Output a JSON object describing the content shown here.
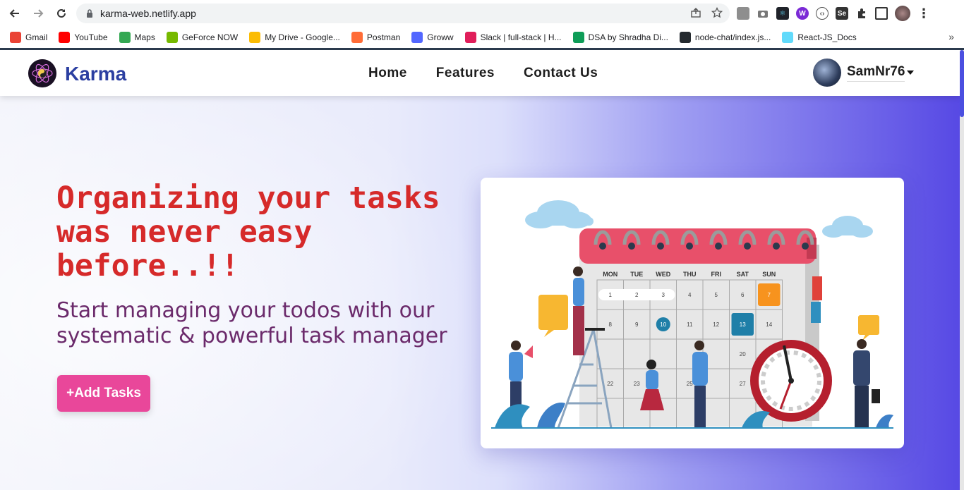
{
  "browser": {
    "url": "karma-web.netlify.app",
    "bookmarks": [
      {
        "label": "Gmail",
        "color": "#ea4335"
      },
      {
        "label": "YouTube",
        "color": "#ff0000"
      },
      {
        "label": "Maps",
        "color": "#34a853"
      },
      {
        "label": "GeForce NOW",
        "color": "#76b900"
      },
      {
        "label": "My Drive - Google...",
        "color": "#fbbc04"
      },
      {
        "label": "Postman",
        "color": "#ff6c37"
      },
      {
        "label": "Groww",
        "color": "#5367ff"
      },
      {
        "label": "Slack | full-stack | H...",
        "color": "#e01e5a"
      },
      {
        "label": "DSA by Shradha Di...",
        "color": "#0f9d58"
      },
      {
        "label": "node-chat/index.js...",
        "color": "#24292e"
      },
      {
        "label": "React-JS_Docs",
        "color": "#61dafb"
      }
    ],
    "more": "»"
  },
  "site": {
    "brand": "Karma",
    "nav": {
      "home": "Home",
      "features": "Features",
      "contact": "Contact Us"
    },
    "user": "SamNr76"
  },
  "hero": {
    "title": "Organizing your tasks was never easy before..!!",
    "subtitle": "Start managing your todos with our systematic & powerful task manager",
    "button": "+Add Tasks"
  },
  "illustration": {
    "days": [
      "MON",
      "TUE",
      "WED",
      "THU",
      "FRI",
      "SAT",
      "SUN"
    ],
    "dates": [
      "1",
      "2",
      "3",
      "4",
      "5",
      "6",
      "7",
      "8",
      "9",
      "10",
      "11",
      "12",
      "13",
      "14",
      "20",
      "22",
      "23",
      "25",
      "27"
    ]
  },
  "colors": {
    "title": "#d62a2a",
    "subtitle": "#6b2a6b",
    "button": "#e9479a",
    "brand": "#2b3fa1",
    "gradient_end": "#5648e4"
  }
}
